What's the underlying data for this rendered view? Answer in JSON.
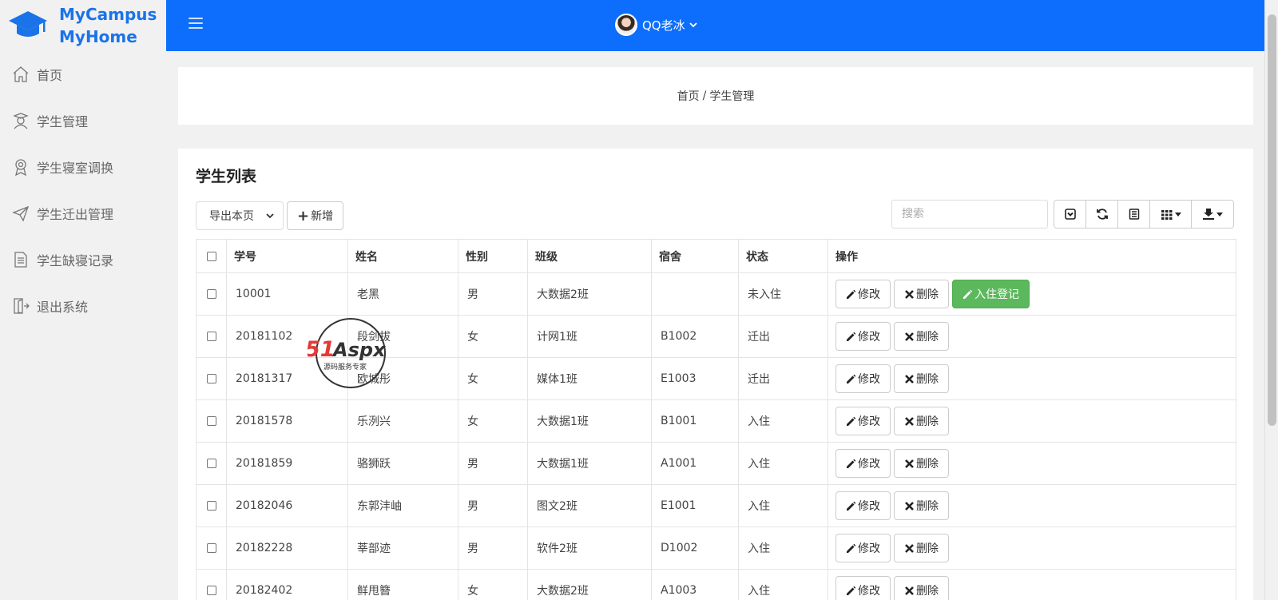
{
  "brand": {
    "line1": "MyCampus",
    "line2": "MyHome",
    "color": "#1a73e8"
  },
  "sidebar": {
    "items": [
      {
        "label": "首页",
        "icon": "home-icon"
      },
      {
        "label": "学生管理",
        "icon": "student-icon"
      },
      {
        "label": "学生寝室调换",
        "icon": "badge-icon"
      },
      {
        "label": "学生迁出管理",
        "icon": "send-icon"
      },
      {
        "label": "学生缺寝记录",
        "icon": "document-icon"
      },
      {
        "label": "退出系统",
        "icon": "exit-icon"
      }
    ]
  },
  "topbar": {
    "user_name": "QQ老冰",
    "color": "#0d6efd"
  },
  "breadcrumb": {
    "home": "首页",
    "current": "学生管理"
  },
  "main": {
    "title": "学生列表",
    "export_select": "导出本页",
    "add_label": "新增",
    "search_placeholder": "搜索",
    "columns": [
      "学号",
      "姓名",
      "性别",
      "班级",
      "宿舍",
      "状态",
      "操作"
    ],
    "edit_label": "修改",
    "delete_label": "删除",
    "checkin_label": "入住登记",
    "rows": [
      {
        "id": "10001",
        "name": "老黑",
        "gender": "男",
        "class": "大数据2班",
        "dorm": "",
        "status": "未入住",
        "checkin": true
      },
      {
        "id": "20181102",
        "name": "段剑拔",
        "gender": "女",
        "class": "计网1班",
        "dorm": "B1002",
        "status": "迁出",
        "checkin": false
      },
      {
        "id": "20181317",
        "name": "欧城彤",
        "gender": "女",
        "class": "媒体1班",
        "dorm": "E1003",
        "status": "迁出",
        "checkin": false
      },
      {
        "id": "20181578",
        "name": "乐洌兴",
        "gender": "女",
        "class": "大数据1班",
        "dorm": "B1001",
        "status": "入住",
        "checkin": false
      },
      {
        "id": "20181859",
        "name": "骆狮跃",
        "gender": "男",
        "class": "大数据1班",
        "dorm": "A1001",
        "status": "入住",
        "checkin": false
      },
      {
        "id": "20182046",
        "name": "东郭沣岫",
        "gender": "男",
        "class": "图文2班",
        "dorm": "E1001",
        "status": "入住",
        "checkin": false
      },
      {
        "id": "20182228",
        "name": "莘部迹",
        "gender": "男",
        "class": "软件2班",
        "dorm": "D1002",
        "status": "入住",
        "checkin": false
      },
      {
        "id": "20182402",
        "name": "鲜甩簪",
        "gender": "女",
        "class": "大数据2班",
        "dorm": "A1003",
        "status": "入住",
        "checkin": false
      }
    ],
    "checkin_color": "#5cb85c"
  },
  "watermark": {
    "logo": "51Aspx",
    "tagline": "源码服务专家"
  }
}
